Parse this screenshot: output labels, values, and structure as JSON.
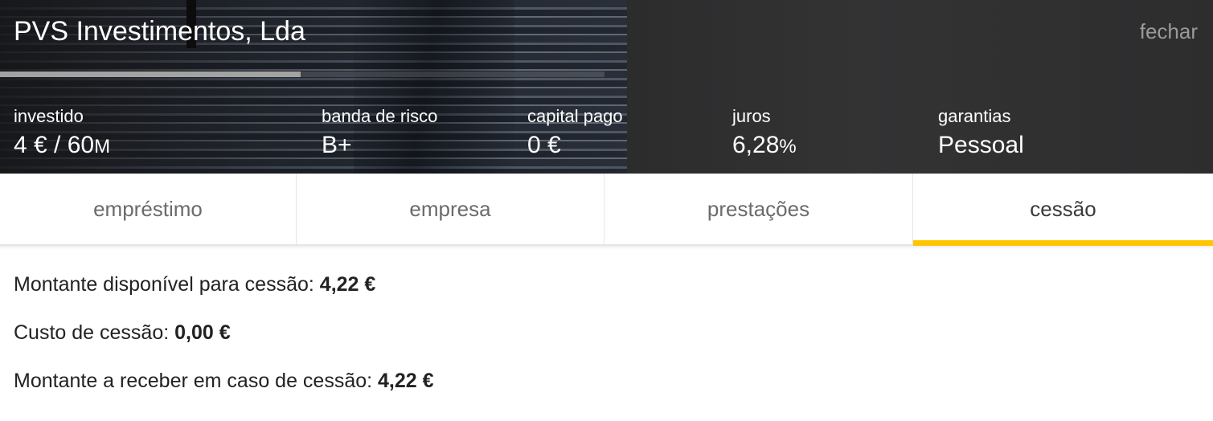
{
  "header": {
    "title": "PVS Investimentos, Lda",
    "close_label": "fechar",
    "funding_progress": 0.498
  },
  "stats": [
    {
      "label": "investido",
      "value": "4 € / 60",
      "unit": "M"
    },
    {
      "label": "banda de risco",
      "value": "B+",
      "unit": ""
    },
    {
      "label": "capital pago",
      "value": "0 €",
      "unit": ""
    },
    {
      "label": "juros",
      "value": "6,28",
      "unit": "%"
    },
    {
      "label": "garantias",
      "value": "Pessoal",
      "unit": ""
    }
  ],
  "tabs": [
    {
      "label": "empréstimo"
    },
    {
      "label": "empresa"
    },
    {
      "label": "prestações"
    },
    {
      "label": "cessão"
    }
  ],
  "active_tab": "cessão",
  "accent_color": "#ffc500",
  "cession": {
    "available_label": "Montante disponível para cessão: ",
    "available_value": "4,22 €",
    "cost_label": "Custo de cessão: ",
    "cost_value": "0,00 €",
    "receive_label": "Montante a receber em caso de cessão: ",
    "receive_value": "4,22 €"
  }
}
